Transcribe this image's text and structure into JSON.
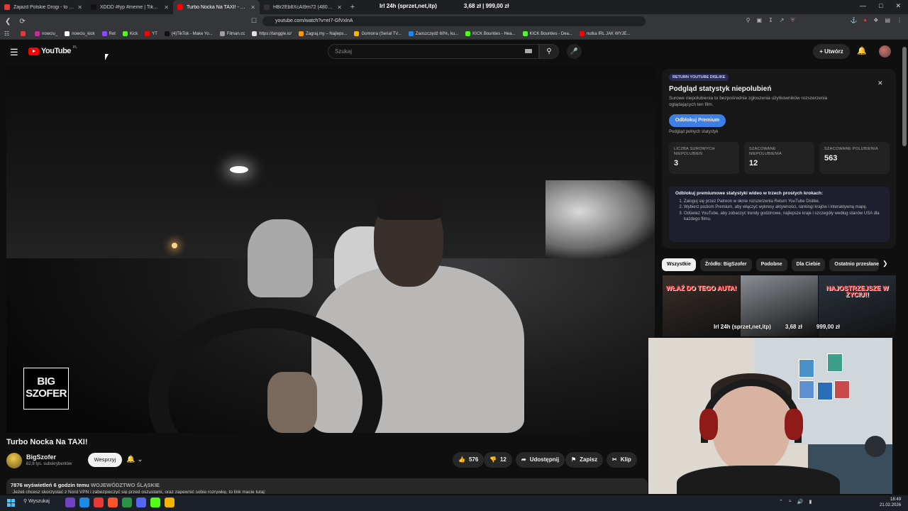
{
  "browser": {
    "tabs": [
      {
        "label": "Zajazd Polskie Drogi - to miał być ro",
        "color": "#e53935",
        "active": false
      },
      {
        "label": "XDDD #fyp #meme | TikTok",
        "color": "#111111",
        "active": false
      },
      {
        "label": "Turbo Nocka Na TAXI! - YouTube",
        "color": "#ff0000",
        "active": true
      },
      {
        "label": "HBr2Eb8XcAI9m72 (480×512)",
        "color": "#333333",
        "active": false
      }
    ],
    "ticker": {
      "left": "Irl 24h (sprzet,net,itp)",
      "right": "3,68 zł  |  999,00 zł"
    },
    "url": "youtube.com/watch?v=eI7-GfVxlnA",
    "bookmarks": [
      {
        "label": "",
        "color": "#e53935"
      },
      {
        "label": "nowciu_",
        "color": "#d6249f"
      },
      {
        "label": "nowciu_kick",
        "color": "#ffffff"
      },
      {
        "label": "Ret",
        "color": "#9146ff"
      },
      {
        "label": "Kick",
        "color": "#53fc18"
      },
      {
        "label": "YT",
        "color": "#ff0000"
      },
      {
        "label": "(4)TikTok - Make Yo...",
        "color": "#111111"
      },
      {
        "label": "Filman.cc",
        "color": "#9e9e9e"
      },
      {
        "label": "https://tanggle.io/",
        "color": "#e0e0e0"
      },
      {
        "label": "Zagraj.my – Najleps...",
        "color": "#ff9800"
      },
      {
        "label": "Gomorra (Serial TV...",
        "color": "#f4b400"
      },
      {
        "label": "Zaoszczędź 60%, ku...",
        "color": "#1e88e5"
      },
      {
        "label": "KICK Bounties - Hea...",
        "color": "#53fc18"
      },
      {
        "label": "KICK Bounties - Dea...",
        "color": "#53fc18"
      },
      {
        "label": "nutka IRL JAK WYJE...",
        "color": "#ff0000"
      }
    ]
  },
  "youtube": {
    "logo_text": "YouTube",
    "country": "PL",
    "search_placeholder": "Szukaj",
    "create_label": "Utwórz"
  },
  "video": {
    "overlay_logo_line1": "BIG",
    "overlay_logo_line2": "SZOFER",
    "title": "Turbo Nocka Na TAXI!",
    "channel": "BigSzofer",
    "subscribers": "62,8 tys. subskrybentów",
    "support_label": "Wesprzyj",
    "likes": "576",
    "dislikes": "12",
    "share_label": "Udostępnij",
    "save_label": "Zapisz",
    "clip_label": "Klip",
    "views_line": "7876 wyświetleń  6 godzin temu",
    "location": "WOJEWÓDZTWO ŚLĄSKIE",
    "description": "Jeżeli chcesz skorzystać z Nord VPN i zabezpieczyć się przed oszustami, oraz zapewnić sobie rozrywkę, to link macie tutaj:"
  },
  "ryd": {
    "badge": "RETURN YOUTUBE DISLIKE",
    "title": "Podgląd statystyk niepolubień",
    "desc": "Surowe niepolubienia to bezpośrednie zgłoszenia użytkowników rozszerzenia oglądających ten film.",
    "premium_button": "Odblokuj Premium",
    "preview_link": "Podgląd pełnych statystyk",
    "stats": [
      {
        "label": "LICZBA SUROWYCH NIEPOLUBIEŃ",
        "value": "3"
      },
      {
        "label": "SZACOWANE NIEPOLUBIENIA",
        "value": "12"
      },
      {
        "label": "SZACOWANE POLUBIENIA",
        "value": "563"
      }
    ],
    "steps_title": "Odblokuj premiumowe statystyki wideo w trzech prostych krokach:",
    "steps": [
      "Zaloguj się przez Patreon w oknie rozszerzenia Return YouTube Dislike.",
      "Wybierz poziom Premium, aby włączyć wykresy aktywności, rankingi krajów i interaktywną mapę.",
      "Odśwież YouTube, aby zobaczyć trendy godzinowe, najlepsze kraje i szczegóły według stanów USA dla każdego filmu."
    ]
  },
  "chips": [
    "Wszystkie",
    "Źródło: BigSzofer",
    "Podobne",
    "Dla Ciebie",
    "Ostatnio przesłane"
  ],
  "thumbnails": [
    {
      "caption": "WŁAŹ DO TEGO AUTA!",
      "bg": "#3a2f2a"
    },
    {
      "caption": "",
      "bg": "#8a8f95"
    },
    {
      "caption": "NAJOSTRZEJSZE W ŻYCIU!!",
      "bg": "#2c3440"
    }
  ],
  "overlay_ticker": {
    "left": "Irl 24h (sprzet,net,itp)",
    "mid": "3,68 zł",
    "right": "999,00 zł"
  },
  "taskbar": {
    "search_label": "Wyszukaj",
    "time": "18:49",
    "date": "21.02.2026",
    "apps": [
      "#6f42c1",
      "#1e88e5",
      "#e53935",
      "#fb542b",
      "#2b9348",
      "#5865f2",
      "#53fc18",
      "#f4b400"
    ]
  },
  "colors": {
    "yt_red": "#ff0000",
    "accent_blue": "#3d7fe6"
  }
}
